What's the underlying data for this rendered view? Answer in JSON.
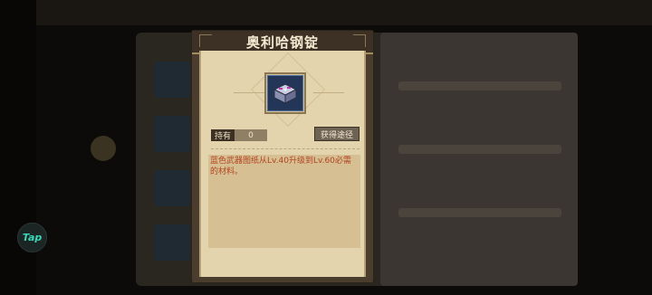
{
  "dialog": {
    "title": "奥利哈钢锭",
    "item_icon": "ingot-chest-icon",
    "own_label": "持有",
    "own_count": "0",
    "obtain_button": "获得途径",
    "description": "蓝色武器图纸从Lv.40升级到Lv.60必需的材料。"
  },
  "floating": {
    "tap_label": "Tap"
  },
  "colors": {
    "dialog_bg": "#e4d4ad",
    "title_bar": "#3c3124",
    "description_text": "#b4441f",
    "tap_accent": "#3ad6b8"
  }
}
